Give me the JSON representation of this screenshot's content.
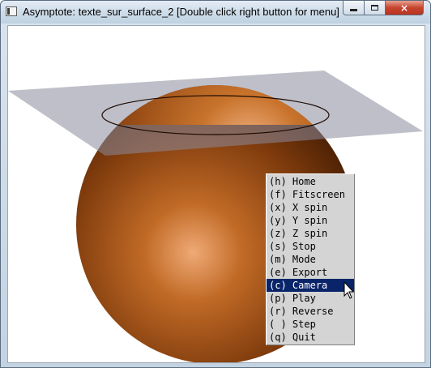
{
  "window": {
    "title": "Asymptote: texte_sur_surface_2 [Double click right button for menu]",
    "icon": "app-icon",
    "buttons": {
      "minimize": "minimize",
      "maximize": "maximize",
      "close": "×"
    }
  },
  "colors": {
    "sphere_light": "#f3b586",
    "sphere_mid": "#b5621e",
    "sphere_dark": "#3e1b03",
    "plane": "#8a8a9c",
    "menu_bg": "#d4d4d4",
    "menu_selected": "#0a246a"
  },
  "menu": {
    "items": [
      {
        "label": "(h) Home"
      },
      {
        "label": "(f) Fitscreen"
      },
      {
        "label": "(x) X spin"
      },
      {
        "label": "(y) Y spin"
      },
      {
        "label": "(z) Z spin"
      },
      {
        "label": "(s) Stop"
      },
      {
        "label": "(m) Mode"
      },
      {
        "label": "(e) Export"
      },
      {
        "label": "(c) Camera",
        "selected": true
      },
      {
        "label": "(p) Play"
      },
      {
        "label": "(r) Reverse"
      },
      {
        "label": "( ) Step"
      },
      {
        "label": "(q) Quit"
      }
    ]
  },
  "cursor": {
    "icon": "mouse-pointer-icon"
  }
}
